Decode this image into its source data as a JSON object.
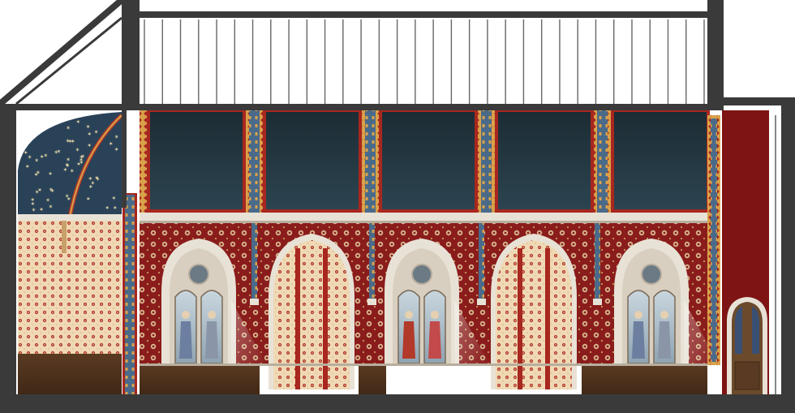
{
  "drawing": {
    "subject": "church-interior-elevation",
    "colors": {
      "structure": "#3a3a3a",
      "panel_dark": "#223640",
      "panel_dark_top": "#1c2c34",
      "border_gold": "#d9a24a",
      "border_red": "#a8271f",
      "wall_red": "#8a1c1c",
      "wall_red_dot": "#d8b890",
      "cream": "#efd9b4",
      "cream_dot": "#b23a2a",
      "dado_brown": "#5a3a22",
      "dado_brown_dark": "#3f2816",
      "stone": "#e8e2d6",
      "stone_shadow": "#b8ae9e",
      "apse_blue": "#2a4258",
      "star": "#e8d9a8",
      "chancel_red": "#7e1414",
      "door_wood": "#6b4a2c",
      "door_glass": "#3a4f74"
    },
    "railing_balusters": 32,
    "clerestory_panels": 5,
    "lancet_windows": 3,
    "blind_arches": 2,
    "apse_stars": 55
  }
}
